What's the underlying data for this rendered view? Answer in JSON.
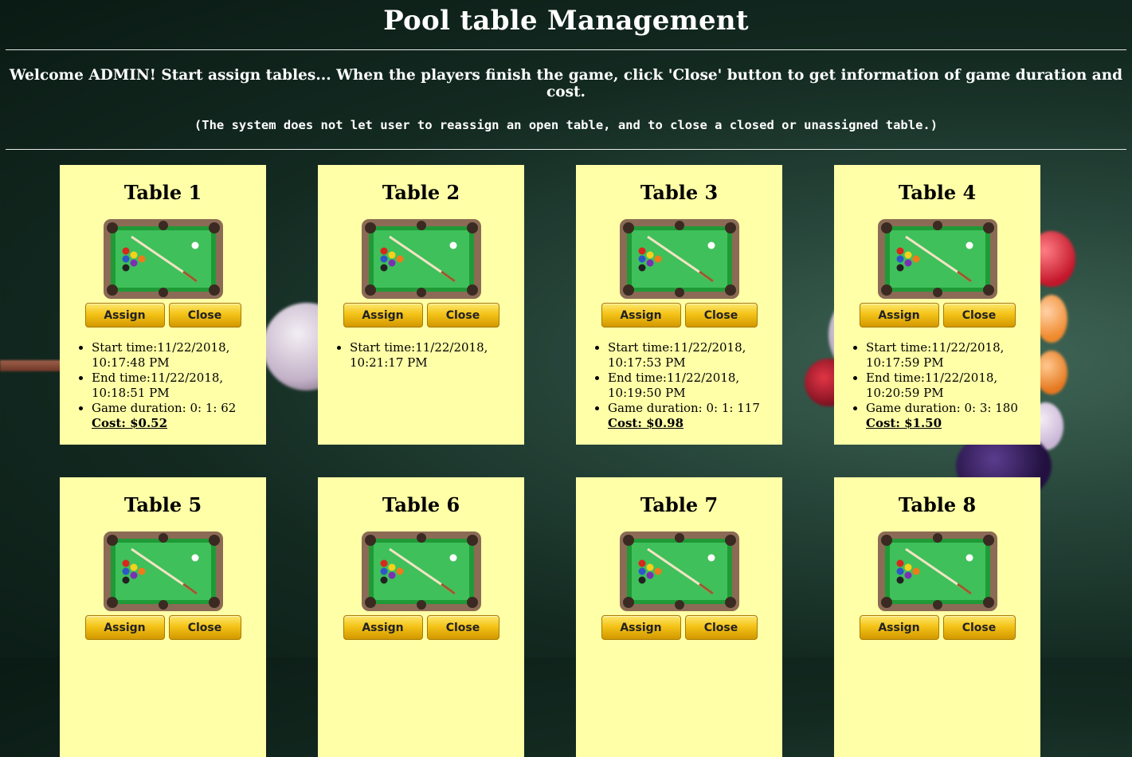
{
  "header": {
    "title": "Pool table Management",
    "welcome": "Welcome ADMIN! Start assign tables... When the players finish the game, click 'Close' button to get information of game duration and cost.",
    "note": "(The system does not let user to reassign an open table, and to close a closed or unassigned table.)"
  },
  "buttons": {
    "assign": "Assign",
    "close": "Close"
  },
  "tables": [
    {
      "name": "Table 1",
      "start": "Start time:11/22/2018, 10:17:48 PM",
      "end": "End time:11/22/2018, 10:18:51 PM",
      "duration": "Game duration: 0: 1: 62",
      "cost": "Cost: $0.52"
    },
    {
      "name": "Table 2",
      "start": "Start time:11/22/2018, 10:21:17 PM"
    },
    {
      "name": "Table 3",
      "start": "Start time:11/22/2018, 10:17:53 PM",
      "end": "End time:11/22/2018, 10:19:50 PM",
      "duration": "Game duration: 0: 1: 117",
      "cost": "Cost: $0.98"
    },
    {
      "name": "Table 4",
      "start": "Start time:11/22/2018, 10:17:59 PM",
      "end": "End time:11/22/2018, 10:20:59 PM",
      "duration": "Game duration: 0: 3: 180",
      "cost": "Cost: $1.50"
    },
    {
      "name": "Table 5"
    },
    {
      "name": "Table 6"
    },
    {
      "name": "Table 7"
    },
    {
      "name": "Table 8"
    }
  ],
  "colors": {
    "card": "#ffffa8",
    "felt": "#35b84f",
    "rail": "#8b6b55",
    "button": "#f4c318",
    "background": "#132a21"
  },
  "icons": {
    "table": "pool-table-icon"
  }
}
